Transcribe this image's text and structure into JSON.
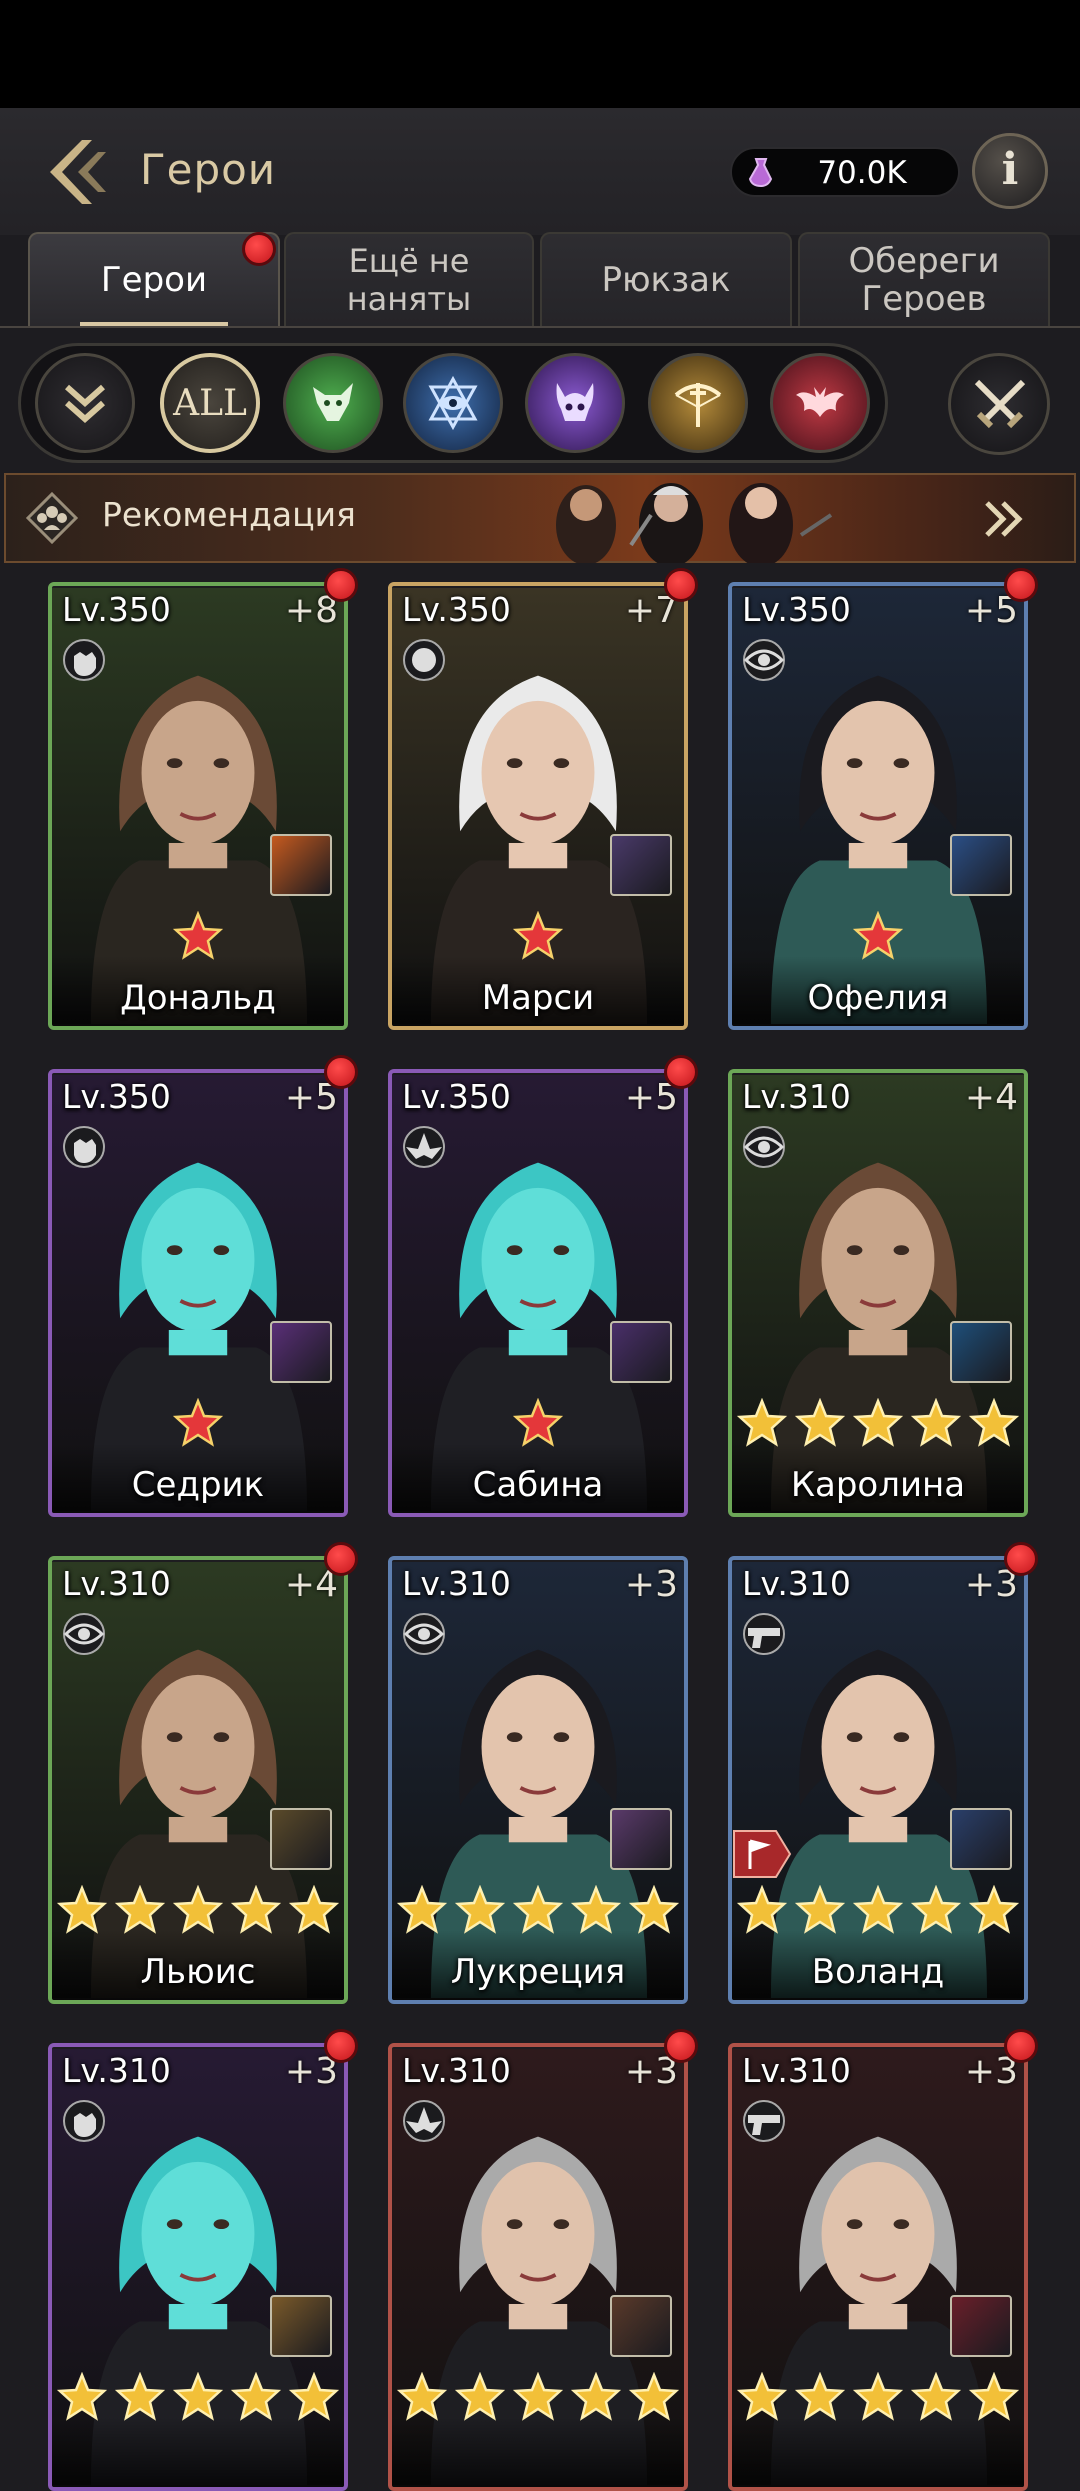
{
  "header": {
    "title": "Герои",
    "currency": "70.0K"
  },
  "tabs": [
    {
      "label": "Герои",
      "active": true,
      "badge": true
    },
    {
      "label": "Ещё не наняты"
    },
    {
      "label": "Рюкзак"
    },
    {
      "label": "Обереги Героев"
    }
  ],
  "filters": [
    "collapse",
    "ALL",
    "beast",
    "eye",
    "demon",
    "hunter",
    "vampire"
  ],
  "filter_all_label": "ALL",
  "recommend": {
    "label": "Рекомендация"
  },
  "heroes": [
    {
      "level": "Lv.350",
      "plus": "+8",
      "name": "Дональд",
      "frame": "green",
      "stars": 1,
      "star_color": "red",
      "badge": true
    },
    {
      "level": "Lv.350",
      "plus": "+7",
      "name": "Марси",
      "frame": "gold",
      "stars": 1,
      "star_color": "red",
      "badge": true
    },
    {
      "level": "Lv.350",
      "plus": "+5",
      "name": "Офелия",
      "frame": "blue",
      "stars": 1,
      "star_color": "red",
      "badge": true
    },
    {
      "level": "Lv.350",
      "plus": "+5",
      "name": "Седрик",
      "frame": "purple",
      "stars": 1,
      "star_color": "red",
      "badge": true
    },
    {
      "level": "Lv.350",
      "plus": "+5",
      "name": "Сабина",
      "frame": "purple",
      "stars": 1,
      "star_color": "red",
      "badge": true
    },
    {
      "level": "Lv.310",
      "plus": "+4",
      "name": "Каролина",
      "frame": "green",
      "stars": 5,
      "star_color": "gold",
      "badge": false
    },
    {
      "level": "Lv.310",
      "plus": "+4",
      "name": "Льюис",
      "frame": "green",
      "stars": 5,
      "star_color": "gold",
      "badge": true
    },
    {
      "level": "Lv.310",
      "plus": "+3",
      "name": "Лукреция",
      "frame": "blue",
      "stars": 5,
      "star_color": "gold",
      "badge": false
    },
    {
      "level": "Lv.310",
      "plus": "+3",
      "name": "Воланд",
      "frame": "blue",
      "stars": 5,
      "star_color": "gold",
      "badge": true
    },
    {
      "level": "Lv.310",
      "plus": "+3",
      "name": "",
      "frame": "purple",
      "stars": 5,
      "star_color": "gold",
      "badge": true
    },
    {
      "level": "Lv.310",
      "plus": "+3",
      "name": "",
      "frame": "red",
      "stars": 5,
      "star_color": "gold",
      "badge": true
    },
    {
      "level": "Lv.310",
      "plus": "+3",
      "name": "",
      "frame": "red",
      "stars": 5,
      "star_color": "gold",
      "badge": true
    }
  ],
  "colors": {
    "accent": "#d8c7a3",
    "badge": "#e0262c",
    "frame_green": "#6ca757",
    "frame_gold": "#c9a463",
    "frame_blue": "#5e7fb0",
    "frame_purple": "#8a5ab6",
    "frame_red": "#b05248"
  }
}
